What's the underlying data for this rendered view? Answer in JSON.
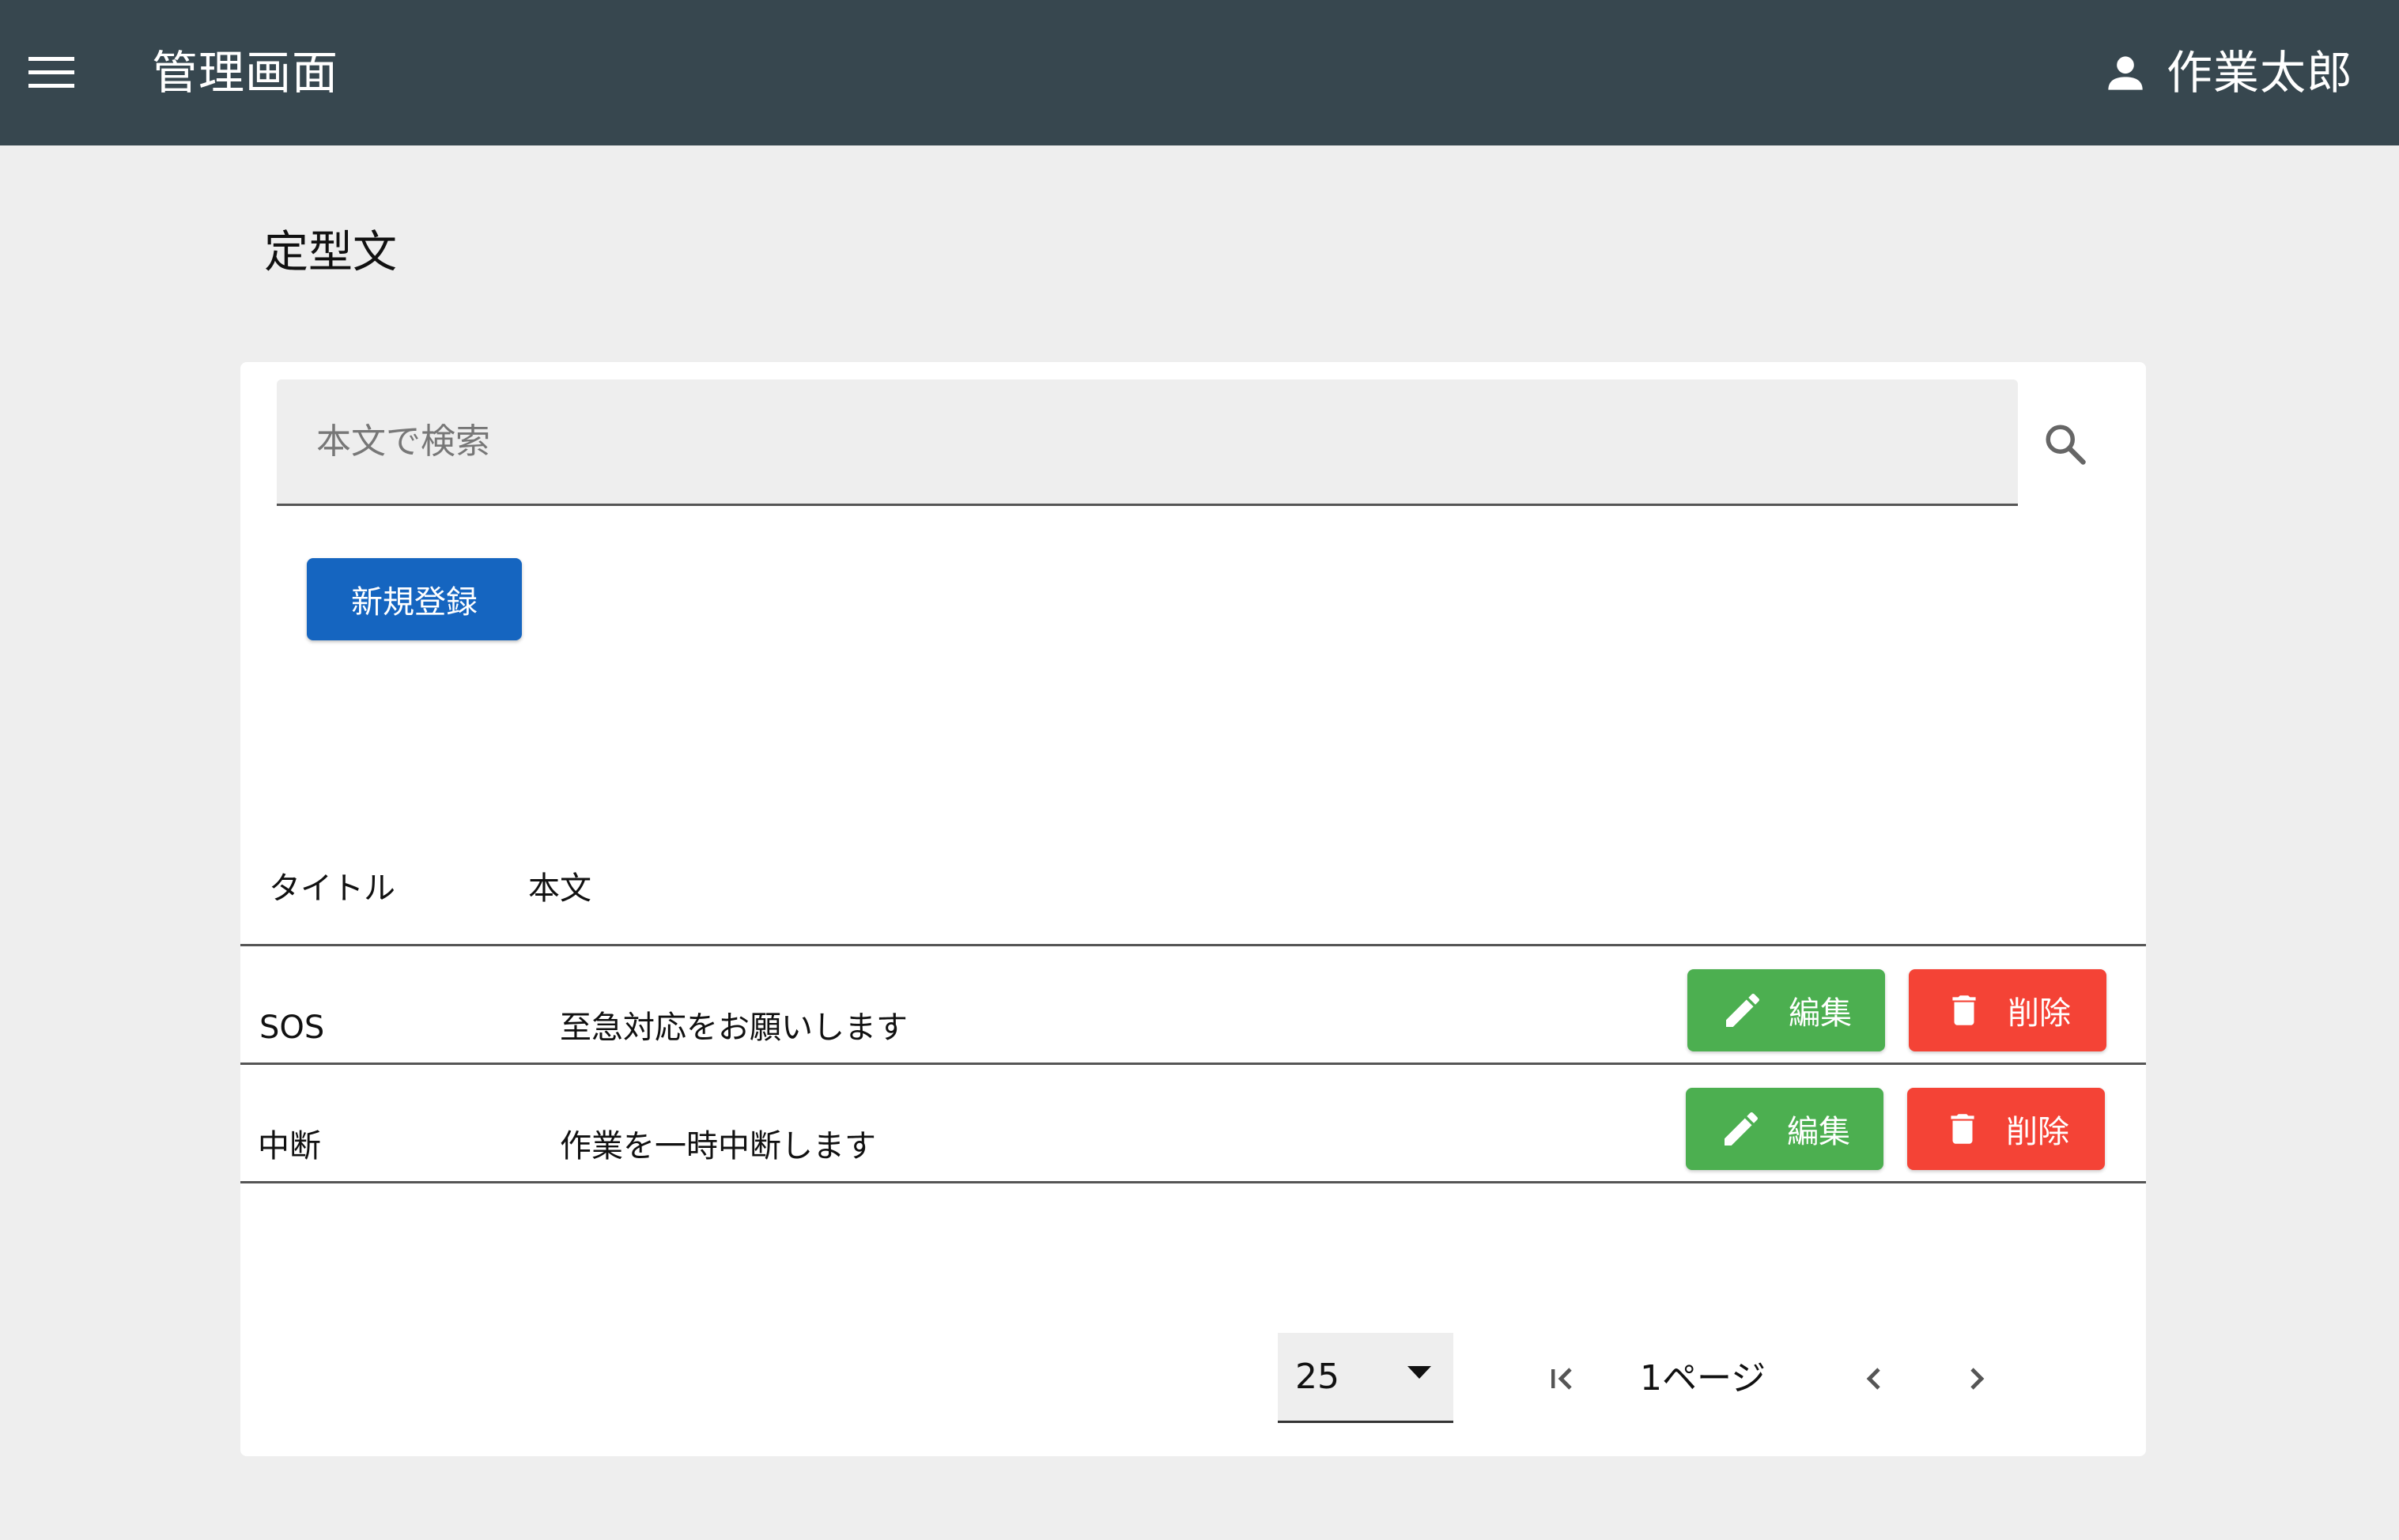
{
  "appbar": {
    "title": "管理画面",
    "user_name": "作業太郎",
    "menu_icon": "hamburger-menu-icon",
    "user_icon": "person-icon"
  },
  "page": {
    "title": "定型文"
  },
  "search": {
    "placeholder": "本文で検索",
    "value": "",
    "icon": "search-icon"
  },
  "new_button_label": "新規登録",
  "table": {
    "columns": [
      "タイトル",
      "本文"
    ],
    "rows": [
      {
        "title": "SOS",
        "body": "至急対応をお願いします",
        "edit_label": "編集",
        "delete_label": "削除"
      },
      {
        "title": "中断",
        "body": "作業を一時中断します",
        "edit_label": "編集",
        "delete_label": "削除"
      }
    ]
  },
  "pagination": {
    "per_page": "25",
    "page_label": "1ページ"
  },
  "colors": {
    "appbar": "#37474f",
    "primary": "#1565c0",
    "edit": "#4caf50",
    "delete": "#f44336",
    "background": "#eeeeee"
  }
}
